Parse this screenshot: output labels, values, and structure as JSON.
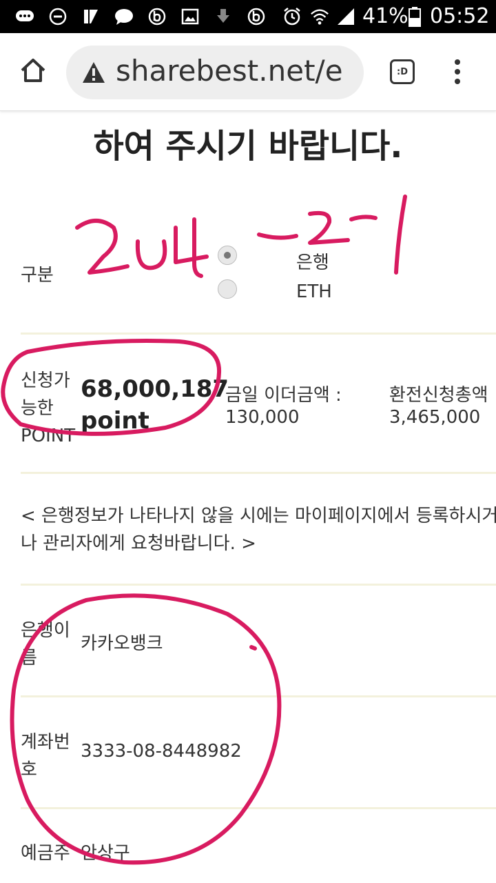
{
  "status_bar": {
    "battery_percent": "41%",
    "time": "05:52",
    "icons": [
      "chat-icon",
      "do-not-disturb-icon",
      "app-icon",
      "message-icon",
      "b-app-icon",
      "gallery-icon",
      "download-icon",
      "b-app-icon",
      "alarm-icon",
      "wifi-icon",
      "signal-icon",
      "battery-icon"
    ]
  },
  "browser": {
    "url": "sharebest.net/e",
    "tab_label": ":D"
  },
  "page": {
    "heading": "하여 주시기 바랍니다.",
    "type_label": "구분",
    "options": [
      {
        "label": "은행",
        "selected": true
      },
      {
        "label": "ETH",
        "selected": false
      }
    ],
    "available_label": "신청가능한 POINT",
    "available_points": "68,000,187",
    "points_unit": "point",
    "eth_price_label": "금일 이더금액 :",
    "eth_price_value": "130,000",
    "total_label": "환전신청총액",
    "total_value": "3,465,000",
    "notice": "< 은행정보가 나타나지 않을 시에는 마이페이지에서 등록하시거나 관리자에게 요청바랍니다. >",
    "bank_name_label": "은행이름",
    "bank_name_value": "카카오뱅크",
    "account_label": "계좌번호",
    "account_value": "3333-08-8448982",
    "holder_label": "예금주",
    "holder_value": "안상구"
  },
  "handwriting_annotation": "2014-2-1",
  "colors": {
    "annotation": "#d81b60",
    "divider": "#f3f1dc",
    "status_bar_bg": "#000000"
  }
}
